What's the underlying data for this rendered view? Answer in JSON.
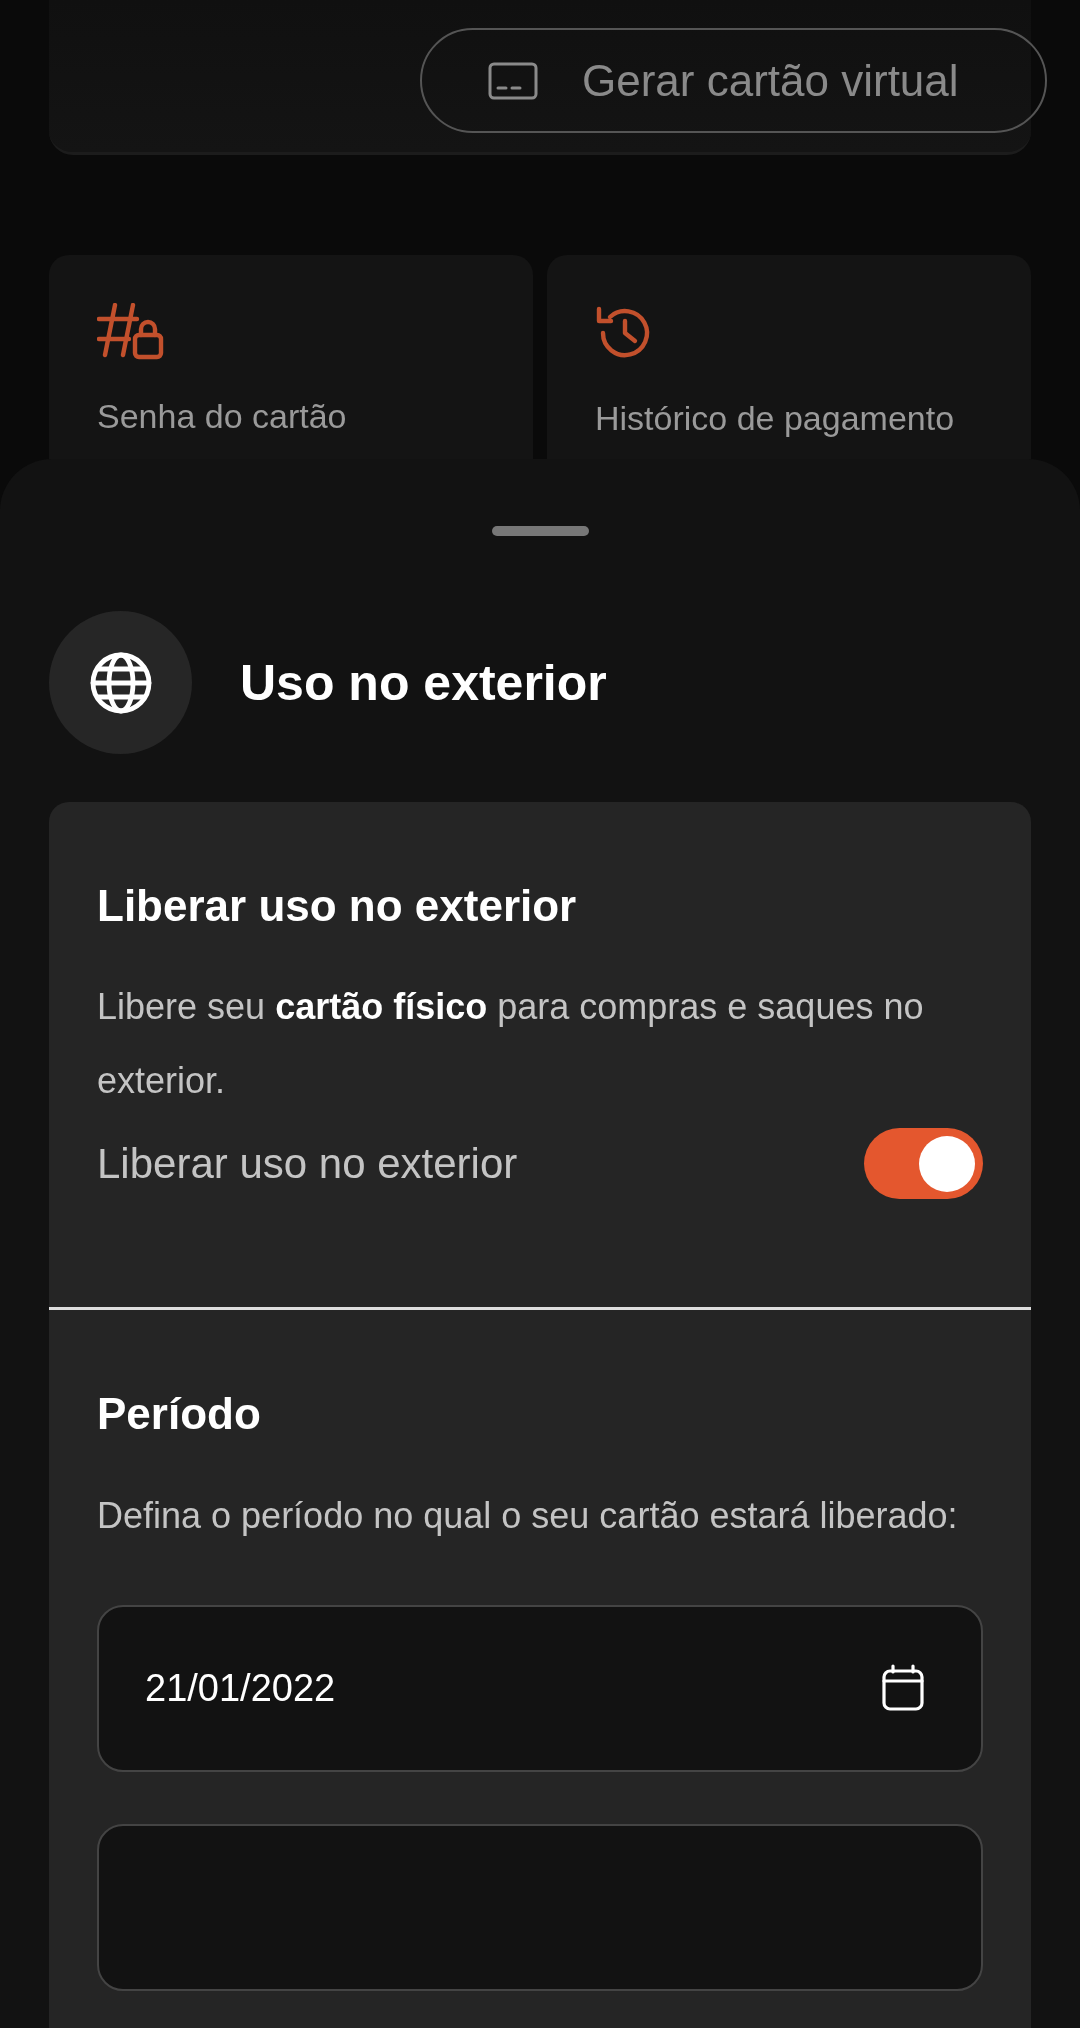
{
  "virtual_card_button": {
    "label": "Gerar cartão virtual"
  },
  "shortcuts": [
    {
      "kind": "password",
      "label": "Senha do cartão"
    },
    {
      "kind": "history",
      "label": "Histórico de pagamento"
    }
  ],
  "sheet": {
    "title": "Uso no exterior",
    "release": {
      "title": "Liberar uso no exterior",
      "description": "Libere seu **cartão físico** para compras e saques no exterior.",
      "toggle_label": "Liberar uso no exterior",
      "on": true
    },
    "period": {
      "title": "Período",
      "description": "Defina o período no qual o seu cartão estará liberado:",
      "start_date": "21/01/2022"
    }
  }
}
